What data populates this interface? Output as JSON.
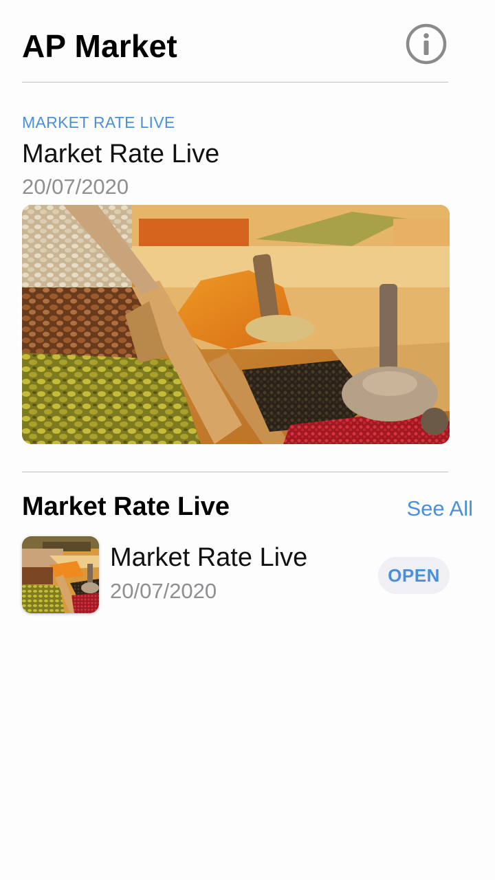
{
  "header": {
    "title": "AP Market",
    "info_icon": "info-circle-icon"
  },
  "featured": {
    "eyebrow": "MARKET RATE LIVE",
    "title": "Market Rate Live",
    "date": "20/07/2020",
    "image": "spice-market-image"
  },
  "section": {
    "title": "Market Rate Live",
    "see_all": "See All"
  },
  "items": [
    {
      "title": "Market Rate Live",
      "date": "20/07/2020",
      "action": "OPEN",
      "image": "spice-market-thumbnail"
    }
  ],
  "colors": {
    "accent": "#4a8fdb",
    "secondary_text": "#8e8e93",
    "divider": "#bdbdbd",
    "button_bg": "#efeff4"
  }
}
